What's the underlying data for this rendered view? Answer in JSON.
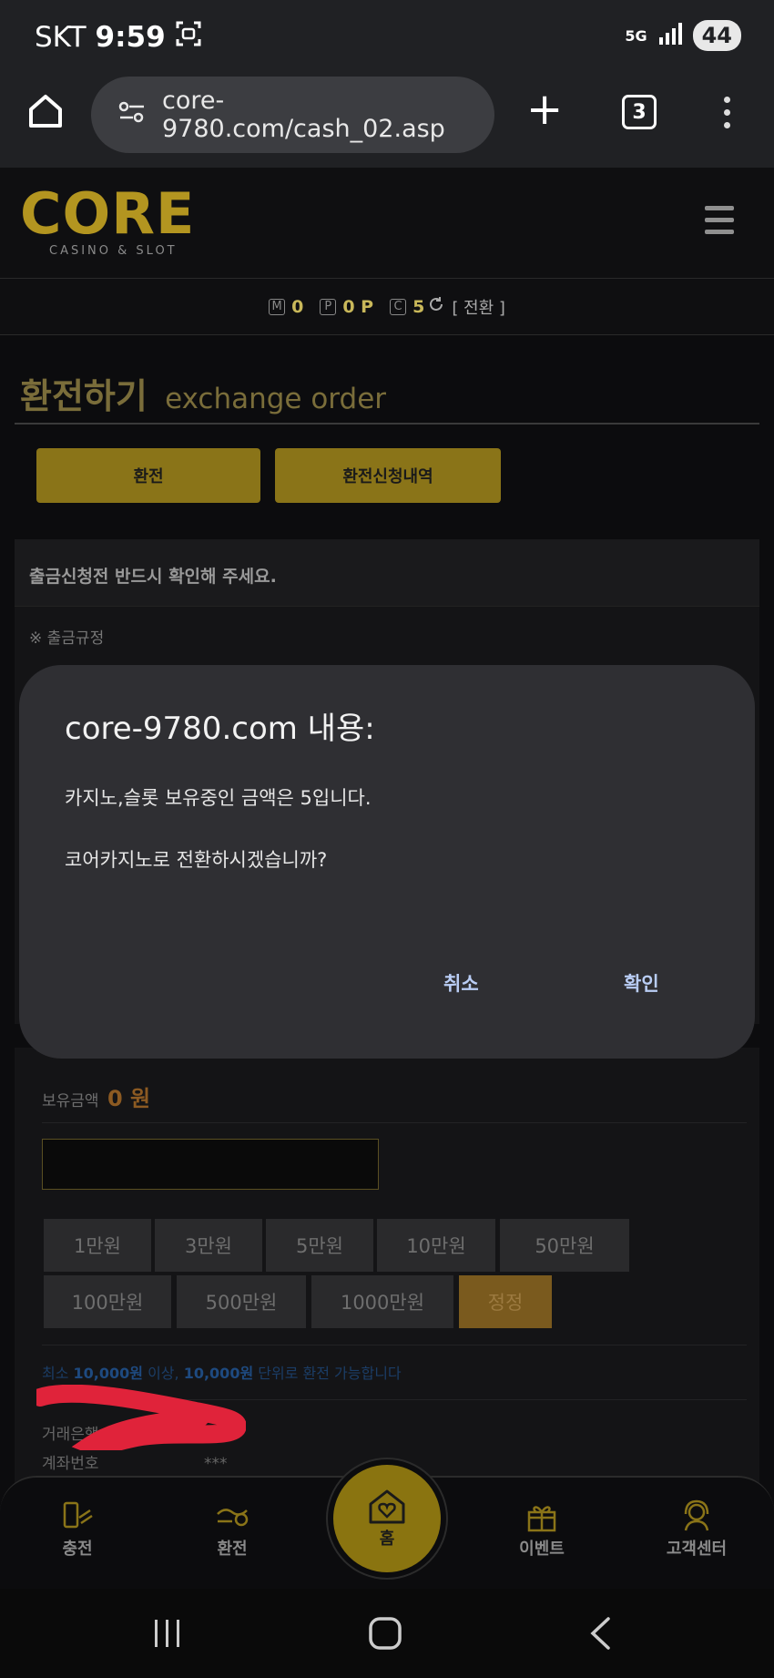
{
  "status_bar": {
    "carrier": "SKT",
    "time": "9:59",
    "network": "5G",
    "battery": "44"
  },
  "browser": {
    "url": "core-9780.com/cash_02.asp",
    "tab_count": "3"
  },
  "site": {
    "logo_text": "CORE",
    "logo_subtitle": "CASINO & SLOT"
  },
  "points": {
    "m_value": "0",
    "p_value": "0 P",
    "c_value": "5",
    "convert_label": "[ 전환 ]"
  },
  "page": {
    "title_ko": "환전하기",
    "title_en": "exchange order"
  },
  "tabs": {
    "exchange": "환전",
    "history": "환전신청내역"
  },
  "notice": {
    "heading": "출금신청전 반드시 확인해 주세요.",
    "rule": "※ 출금규정"
  },
  "form": {
    "balance_label": "보유금액",
    "balance_value": "0 원",
    "chips_row1": [
      "1만원",
      "3만원",
      "5만원",
      "10만원",
      "50만원"
    ],
    "chips_row2": [
      "100만원",
      "500만원",
      "1000만원",
      "정정"
    ],
    "min_note_pre": "최소 ",
    "min_note_amount1": "10,000원",
    "min_note_mid": " 이상, ",
    "min_note_amount2": "10,000원",
    "min_note_post": " 단위로 환전 가능합니다",
    "bank_label": "거래은행",
    "account_label": "계좌번호",
    "account_value": "***"
  },
  "dialog": {
    "title": "core-9780.com 내용:",
    "message1": "카지노,슬롯 보유중인 금액은 5입니다.",
    "message2": "코어카지노로 전환하시겠습니까?",
    "cancel": "취소",
    "confirm": "확인"
  },
  "bottom_nav": {
    "charge": "충전",
    "exchange": "환전",
    "home": "홈",
    "event": "이벤트",
    "support": "고객센터"
  },
  "colors": {
    "gold": "#8a7418",
    "dialog_bg": "#2f2f33",
    "dialog_button": "#b9cdf5"
  }
}
